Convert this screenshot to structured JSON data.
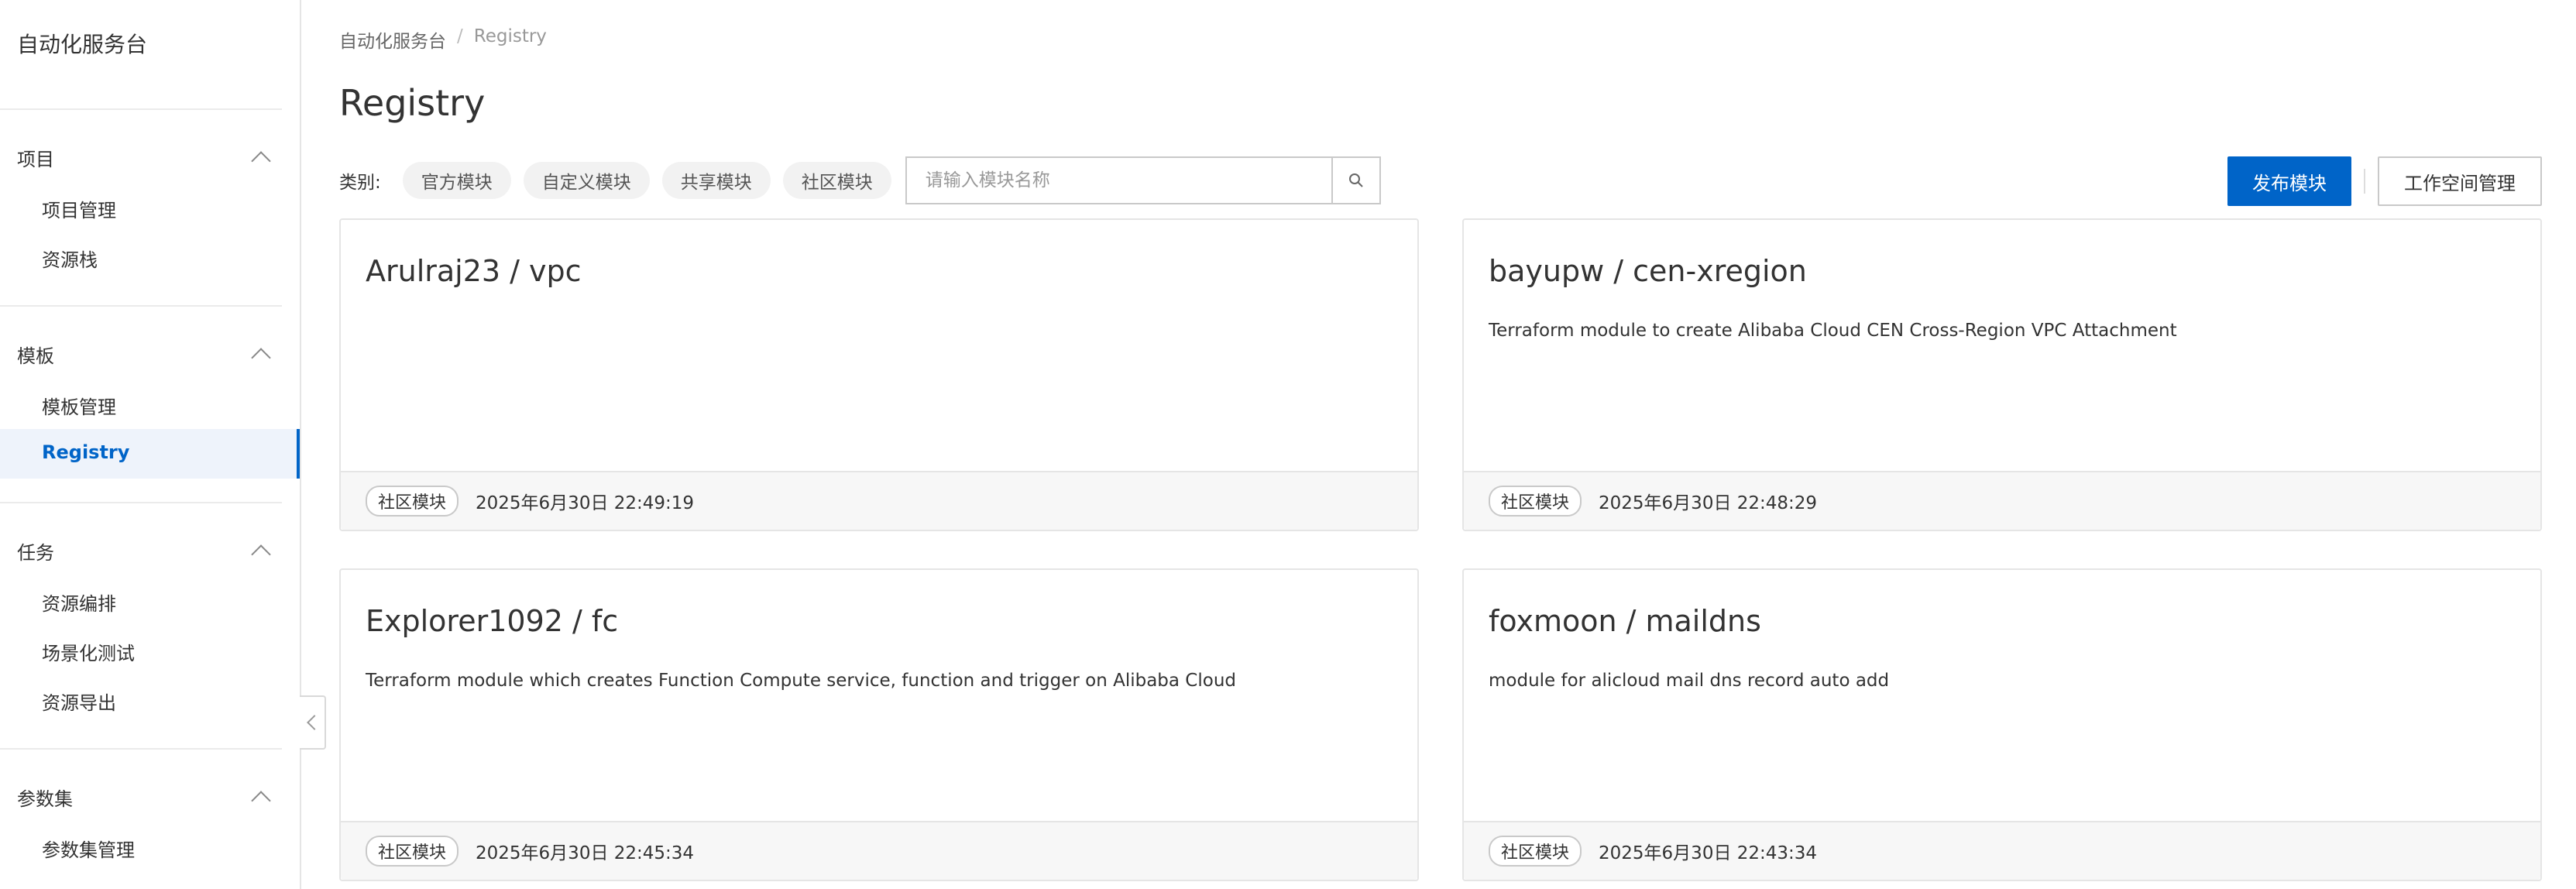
{
  "sidebar": {
    "title": "自动化服务台",
    "groups": [
      {
        "label": "项目",
        "items": [
          "项目管理",
          "资源栈"
        ]
      },
      {
        "label": "模板",
        "items": [
          "模板管理",
          "Registry"
        ]
      },
      {
        "label": "任务",
        "items": [
          "资源编排",
          "场景化测试",
          "资源导出"
        ]
      },
      {
        "label": "参数集",
        "items": [
          "参数集管理"
        ]
      }
    ]
  },
  "breadcrumb": {
    "root": "自动化服务台",
    "sep": "/",
    "current": "Registry"
  },
  "page": {
    "title": "Registry"
  },
  "filter": {
    "label": "类别:",
    "chips": [
      "官方模块",
      "自定义模块",
      "共享模块",
      "社区模块"
    ],
    "search_placeholder": "请输入模块名称"
  },
  "actions": {
    "publish": "发布模块",
    "workspace": "工作空间管理"
  },
  "cards": [
    {
      "title": "Arulraj23 / vpc",
      "desc": "",
      "tag": "社区模块",
      "time": "2025年6月30日 22:49:19"
    },
    {
      "title": "bayupw / cen-xregion",
      "desc": "Terraform module to create Alibaba Cloud CEN Cross-Region VPC Attachment",
      "tag": "社区模块",
      "time": "2025年6月30日 22:48:29"
    },
    {
      "title": "Explorer1092 / fc",
      "desc": "Terraform module which creates Function Compute service, function and trigger on Alibaba Cloud",
      "tag": "社区模块",
      "time": "2025年6月30日 22:45:34"
    },
    {
      "title": "foxmoon / maildns",
      "desc": "module for alicloud mail dns record auto add",
      "tag": "社区模块",
      "time": "2025年6月30日 22:43:34"
    }
  ],
  "colors": {
    "primary": "#0064c8",
    "active_bg": "#eef3fb"
  }
}
